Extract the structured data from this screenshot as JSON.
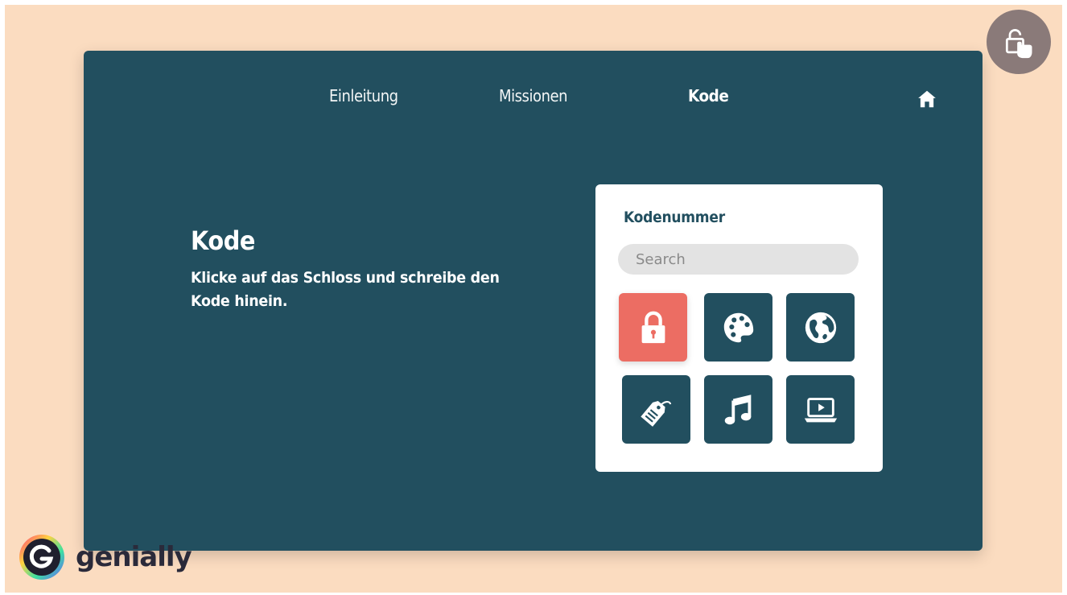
{
  "nav": {
    "items": [
      {
        "label": "Einleitung"
      },
      {
        "label": "Missionen"
      },
      {
        "label": "Kode"
      }
    ],
    "home_icon": "home-icon"
  },
  "main": {
    "heading": "Kode",
    "instructions": "Klicke auf das Schloss und schreibe den Kode hinein."
  },
  "code_panel": {
    "title": "Kodenummer",
    "search_placeholder": "Search",
    "tiles": [
      {
        "icon": "lock-icon",
        "selected": true
      },
      {
        "icon": "palette-icon",
        "selected": false
      },
      {
        "icon": "globe-icon",
        "selected": false
      },
      {
        "icon": "tag-icon",
        "selected": false
      },
      {
        "icon": "music-note-icon",
        "selected": false
      },
      {
        "icon": "video-laptop-icon",
        "selected": false
      }
    ]
  },
  "brand": {
    "name": "genially"
  },
  "colors": {
    "background": "#fbdcc0",
    "slide": "#224f5f",
    "accent": "#ec6d63",
    "card": "#ffffff",
    "search_bg": "#e3e3e3",
    "touch_button": "#8a7a79"
  },
  "touch_icon": "touch-unlock-icon"
}
